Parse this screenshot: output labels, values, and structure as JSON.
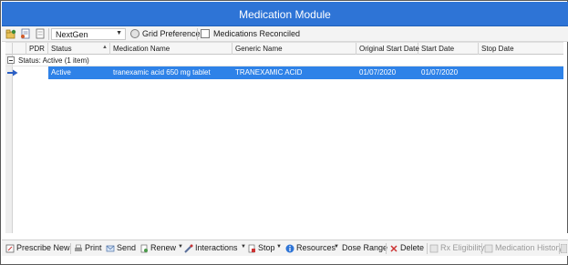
{
  "window": {
    "title": "Medication Module"
  },
  "toolbar": {
    "source_select": {
      "value": "NextGen"
    },
    "grid_preferences_label": "Grid Preferences",
    "reconciled_label": "Medications Reconciled",
    "reconciled_checked": false
  },
  "grid": {
    "columns": {
      "pdr": "PDR",
      "status": "Status",
      "medication_name": "Medication Name",
      "generic_name": "Generic Name",
      "original_start_date": "Original Start Date",
      "start_date": "Start Date",
      "stop_date": "Stop Date"
    },
    "group": {
      "label": "Status:  Active (1 item)"
    },
    "rows": [
      {
        "status": "Active",
        "medication_name": "tranexamic acid 650 mg tablet",
        "generic_name": "TRANEXAMIC ACID",
        "original_start_date": "01/07/2020",
        "start_date": "01/07/2020",
        "stop_date": ""
      }
    ]
  },
  "actions": {
    "prescribe_new": "Prescribe New",
    "print": "Print",
    "send": "Send",
    "renew": "Renew",
    "interactions": "Interactions",
    "stop": "Stop",
    "resources": "Resources",
    "dose_range": "Dose Range",
    "delete": "Delete",
    "rx_eligibility": "Rx Eligibility",
    "medication_history": "Medication History"
  },
  "colors": {
    "title_bar": "#2e74d6",
    "selection": "#2e82e8"
  }
}
